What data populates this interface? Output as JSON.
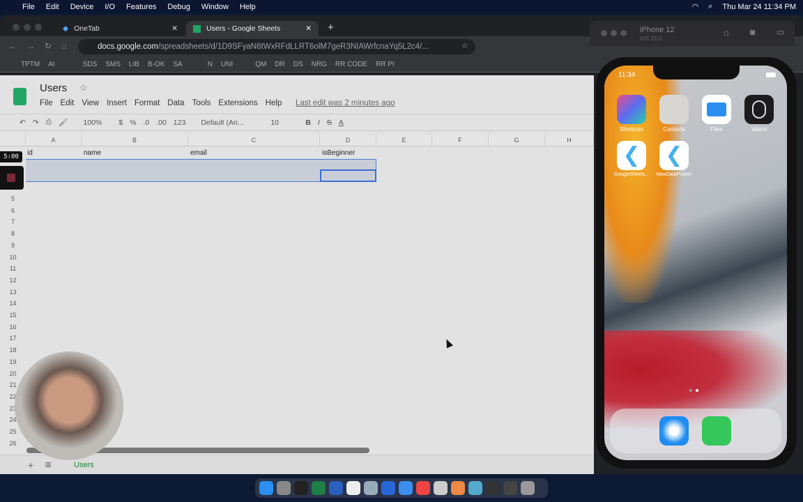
{
  "menubar": {
    "app": "Simulator",
    "items": [
      "File",
      "Edit",
      "Device",
      "I/O",
      "Features",
      "Debug",
      "Window",
      "Help"
    ],
    "clock": "Thu Mar 24  11:34 PM"
  },
  "browser": {
    "tabs": [
      {
        "label": "OneTab"
      },
      {
        "label": "Users - Google Sheets"
      }
    ],
    "url_host": "docs.google.com",
    "url_path": "/spreadsheets/d/1D9SFyaN6tWxRFdLLRT6olM7geR3NIAWrfcnaYq5L2c4/...",
    "bookmarks": [
      "TPTM",
      "AI",
      "SDS",
      "SMS",
      "LIB",
      "B-OK",
      "SA",
      "N",
      "UNI",
      "QM",
      "DR",
      "DS",
      "NRG",
      "RR CODE",
      "RR PI"
    ]
  },
  "sheets": {
    "title": "Users",
    "menus": [
      "File",
      "Edit",
      "View",
      "Insert",
      "Format",
      "Data",
      "Tools",
      "Extensions",
      "Help"
    ],
    "last_edit": "Last edit was 2 minutes ago",
    "toolbar": {
      "zoom": "100%",
      "currency": "$",
      "percent": "%",
      "dec_less": ".0",
      "dec_more": ".00",
      "format": "123",
      "font": "Default (Ari...",
      "font_size": "10"
    },
    "columns": [
      "A",
      "B",
      "C",
      "D",
      "E",
      "F",
      "G",
      "H"
    ],
    "header_row": [
      "id",
      "name",
      "email",
      "isBeginner"
    ],
    "row_numbers": [
      "5",
      "6",
      "7",
      "8",
      "9",
      "10",
      "11",
      "12",
      "13",
      "14",
      "15",
      "16",
      "17",
      "18",
      "19",
      "20",
      "21",
      "22",
      "23",
      "24",
      "25",
      "26"
    ],
    "sheet_tab": "Users"
  },
  "overlay": {
    "timer": "5:00"
  },
  "simulator": {
    "device": "iPhone 12",
    "os": "iOS 15.0",
    "time": "11:34",
    "apps": [
      {
        "label": "Shortcuts"
      },
      {
        "label": "Contacts"
      },
      {
        "label": "Files"
      },
      {
        "label": "Watch"
      },
      {
        "label": "GoogleSheets..."
      },
      {
        "label": "NewDataProject"
      }
    ]
  }
}
